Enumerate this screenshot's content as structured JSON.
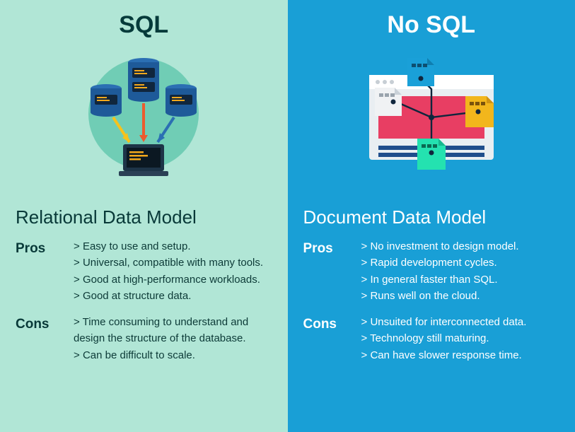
{
  "left": {
    "title": "SQL",
    "model": "Relational Data Model",
    "pros_label": "Pros",
    "cons_label": "Cons",
    "pros": [
      "Easy to use and setup.",
      "Universal, compatible with many tools.",
      "Good at high-performance workloads.",
      "Good at structure data."
    ],
    "cons": [
      "Time consuming to understand and design the structure of the database.",
      "Can be difficult to scale."
    ]
  },
  "right": {
    "title": "No SQL",
    "model": "Document Data Model",
    "pros_label": "Pros",
    "cons_label": "Cons",
    "pros": [
      "No investment to design model.",
      "Rapid development cycles.",
      "In general faster than SQL.",
      "Runs well on the cloud."
    ],
    "cons": [
      "Unsuited for interconnected data.",
      "Technology still maturing.",
      "Can have slower response time."
    ]
  },
  "icons": {
    "left": "sql-servers-to-laptop-illustration",
    "right": "documents-web-layout-illustration"
  }
}
